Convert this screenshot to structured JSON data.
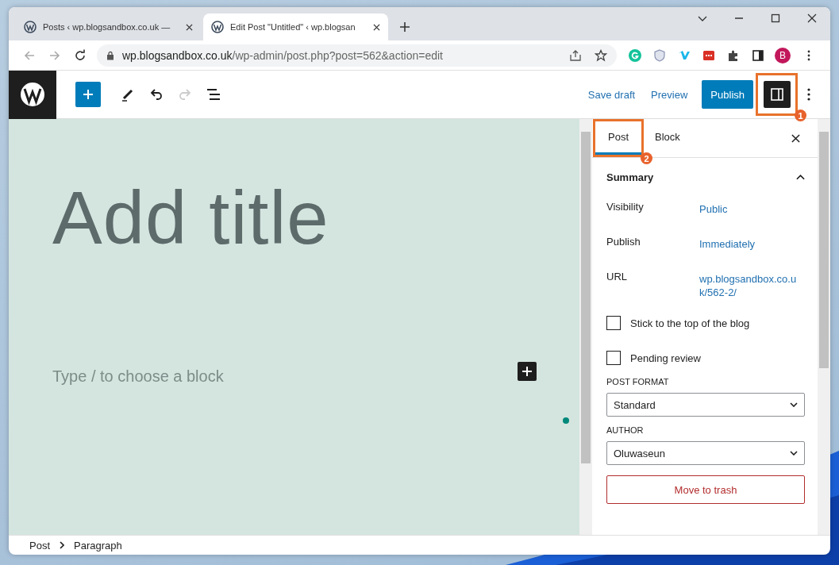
{
  "browser": {
    "tabs": [
      {
        "title": "Posts ‹ wp.blogsandbox.co.uk —",
        "selected": false
      },
      {
        "title": "Edit Post \"Untitled\" ‹ wp.blogsan",
        "selected": true
      }
    ],
    "url_host": "wp.blogsandbox.co.uk",
    "url_path": "/wp-admin/post.php?post=562&action=edit",
    "profile_initial": "B"
  },
  "toolbar": {
    "save_draft": "Save draft",
    "preview": "Preview",
    "publish": "Publish",
    "settings_pressed": true,
    "redo_disabled": true
  },
  "editor": {
    "title_placeholder": "Add title",
    "block_placeholder": "Type / to choose a block"
  },
  "sidebar": {
    "tabs": [
      {
        "label": "Post",
        "selected": true
      },
      {
        "label": "Block",
        "selected": false
      }
    ],
    "panel": {
      "title": "Summary",
      "expanded": true,
      "rows": [
        {
          "label": "Visibility",
          "value": "Public"
        },
        {
          "label": "Publish",
          "value": "Immediately"
        },
        {
          "label": "URL",
          "value": "wp.blogsandbox.co.uk/562-2/"
        }
      ],
      "checkboxes": [
        {
          "label": "Stick to the top of the blog",
          "checked": false
        },
        {
          "label": "Pending review",
          "checked": false
        }
      ],
      "post_format": {
        "label": "POST FORMAT",
        "value": "Standard"
      },
      "author": {
        "label": "AUTHOR",
        "value": "Oluwaseun"
      },
      "trash": "Move to trash"
    }
  },
  "breadcrumb": [
    "Post",
    "Paragraph"
  ],
  "annotations": [
    "1",
    "2"
  ]
}
